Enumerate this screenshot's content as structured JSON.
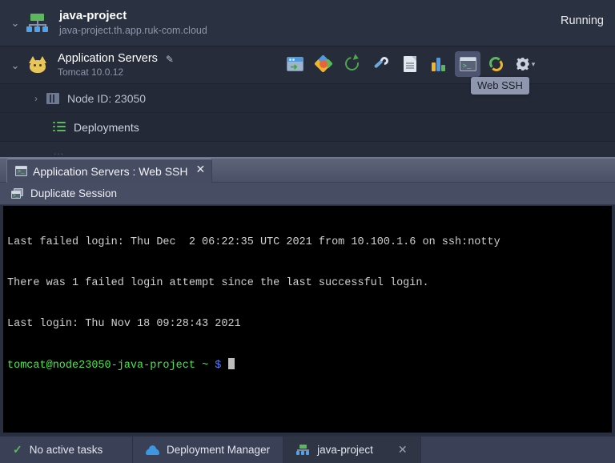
{
  "environment": {
    "name": "java-project",
    "domain": "java-project.th.app.ruk-com.cloud",
    "status": "Running",
    "expand_icon": "chevron-down-icon",
    "logo_icon": "environment-topology-icon"
  },
  "node_group": {
    "title": "Application Servers",
    "engine": "Tomcat 10.0.12",
    "edit_icon": "pencil-icon",
    "expand_icon": "chevron-down-icon",
    "stack_icon": "tomcat-icon"
  },
  "node": {
    "label": "Node ID: 23050",
    "expand_icon": "chevron-right-icon",
    "icon": "server-node-icon"
  },
  "deployments": {
    "label": "Deployments",
    "icon": "deployments-list-icon"
  },
  "toolbar": {
    "buttons": [
      {
        "name": "open-in-browser-button",
        "icon": "browser-window-arrow-icon",
        "title": "Open in Browser"
      },
      {
        "name": "marketplace-button",
        "icon": "marketplace-hexagon-icon",
        "title": "Add-Ons"
      },
      {
        "name": "restart-button",
        "icon": "restart-arrow-icon",
        "title": "Restart Nodes"
      },
      {
        "name": "config-button",
        "icon": "wrench-icon",
        "title": "Config"
      },
      {
        "name": "log-button",
        "icon": "document-icon",
        "title": "Log"
      },
      {
        "name": "statistics-button",
        "icon": "bar-chart-icon",
        "title": "Statistics"
      },
      {
        "name": "web-ssh-button",
        "icon": "terminal-icon",
        "title": "Web SSH"
      },
      {
        "name": "refresh-button",
        "icon": "refresh-circular-arrows-icon",
        "title": "Refresh"
      },
      {
        "name": "settings-button",
        "icon": "gear-icon",
        "title": "Additional"
      }
    ],
    "tooltip": "Web SSH",
    "gear_caret": "▾"
  },
  "ssh_panel": {
    "tab": {
      "label": "Application Servers : Web SSH",
      "icon": "terminal-icon",
      "close": "✕"
    },
    "duplicate_session": {
      "label": "Duplicate Session",
      "icon": "duplicate-window-icon"
    },
    "terminal": {
      "lines": [
        "Last failed login: Thu Dec  2 06:22:35 UTC 2021 from 10.100.1.6 on ssh:notty",
        "There was 1 failed login attempt since the last successful login.",
        "Last login: Thu Nov 18 09:28:43 2021"
      ],
      "prompt_user_host": "tomcat@node23050-java-project",
      "prompt_path": "~",
      "prompt_symbol": "$"
    }
  },
  "statusbar": {
    "tasks_label": "No active tasks",
    "tasks_icon": "check-icon",
    "deployment_manager_label": "Deployment Manager",
    "deployment_manager_icon": "cloud-icon",
    "project_label": "java-project",
    "project_icon": "environment-topology-icon",
    "project_close": "✕"
  },
  "colors": {
    "background": "#232936",
    "header": "#2a3140",
    "panel": "#2a2f3f",
    "terminal_bg": "#000000",
    "accent_green": "#5cb85c",
    "accent_blue": "#4ea3f0",
    "prompt_green": "#4ee44e",
    "prompt_blue": "#5c7cfa",
    "tooltip_bg": "#8e97ad"
  }
}
